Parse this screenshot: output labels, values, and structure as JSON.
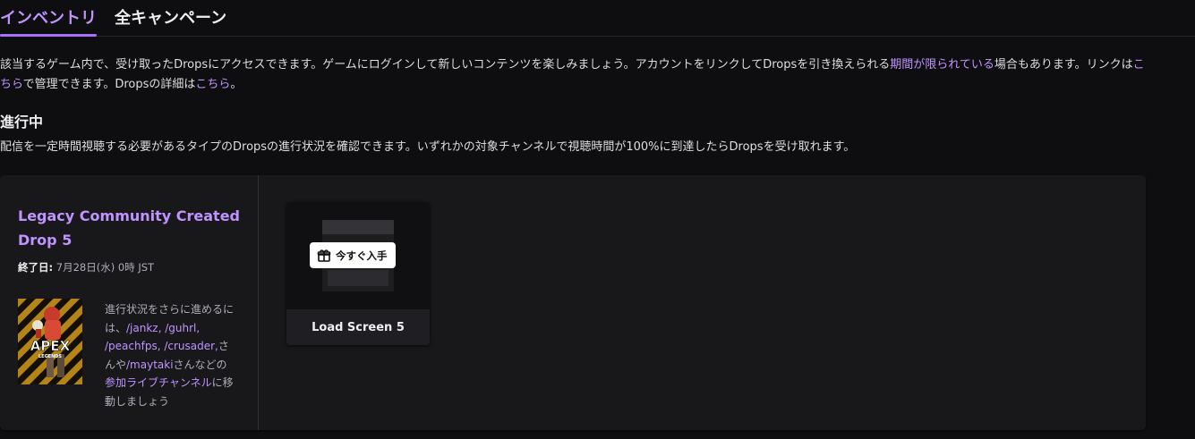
{
  "tabs": {
    "inventory": "インベントリ",
    "campaigns": "全キャンペーン"
  },
  "intro": {
    "text1": "該当するゲーム内で、受け取ったDropsにアクセスできます。ゲームにログインして新しいコンテンツを楽しみましょう。アカウントをリンクしてDropsを引き換えられる",
    "link_limited": "期間が限られている",
    "text2": "場合もあります。リンクは",
    "link_here1": "こちら",
    "text3": "で管理できます。Dropsの詳細は",
    "link_here2": "こちら",
    "text4": "。"
  },
  "in_progress": {
    "title": "進行中",
    "description": "配信を一定時間視聴する必要があるタイプのDropsの進行状況を確認できます。いずれかの対象チャンネルで視聴時間が100%に到達したらDropsを受け取れます。"
  },
  "campaign": {
    "title": "Legacy Community Created Drop 5",
    "end_label": "終了日:",
    "end_value": "7月28日(水) 0時 JST",
    "game_logo_text": "APEX",
    "game_logo_sub": "LEGENDS",
    "note": {
      "prefix": "進行状況をさらに進めるには、",
      "channels": "/jankz, /guhrl, /peachfps, /crusader,",
      "middle": "さんや",
      "channel_last": "/maytaki",
      "middle2": "さんなどの",
      "link_participating": "参加ライブチャンネル",
      "suffix": "に移動しましょう"
    }
  },
  "drop": {
    "name": "Load Screen 5",
    "claim_label": "今すぐ入手",
    "icon": "gift-icon"
  },
  "colors": {
    "accent": "#bf94ff",
    "underline": "#a970ff",
    "background": "#0e0e10",
    "card": "#18181b"
  }
}
